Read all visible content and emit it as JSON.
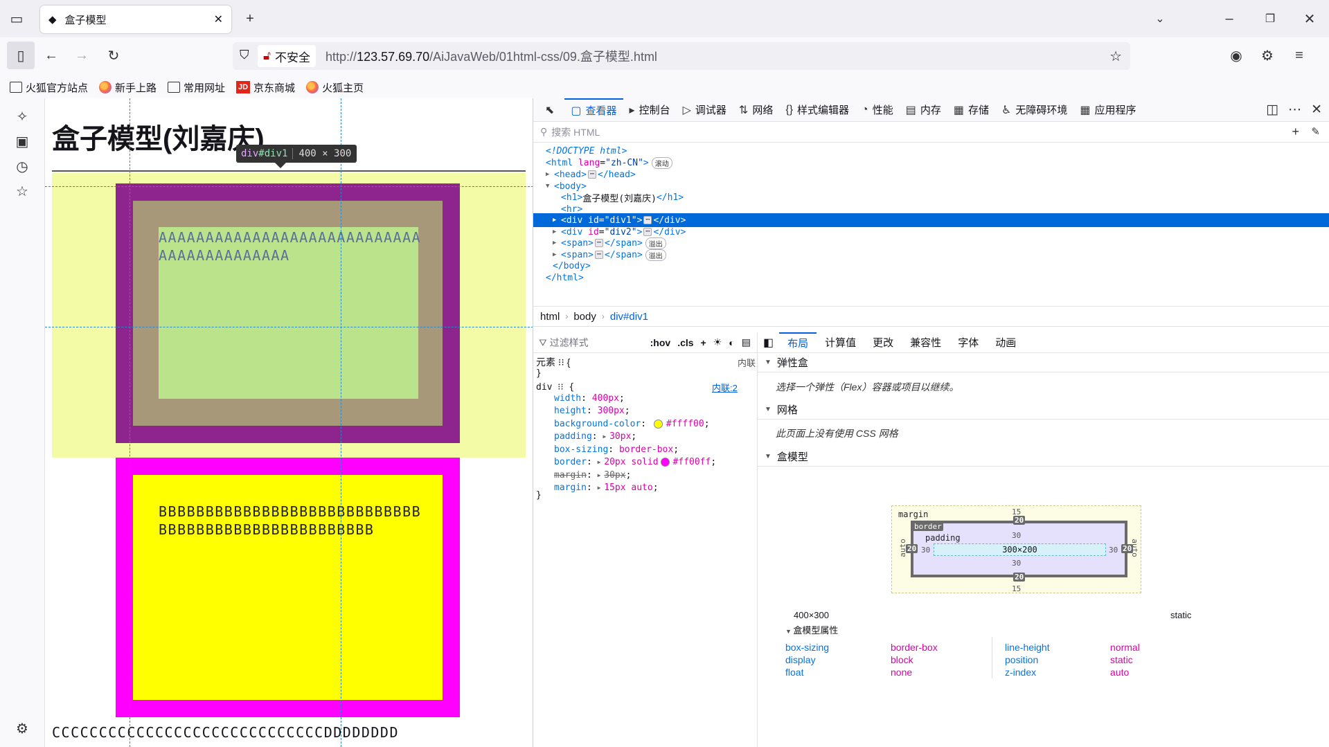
{
  "browser": {
    "tab_title": "盒子模型",
    "url_prefix": "http://",
    "url_host": "123.57.69.70",
    "url_path": "/AiJavaWeb/01html-css/09.盒子模型.html",
    "security_label": "不安全",
    "bookmarks": [
      "火狐官方站点",
      "新手上路",
      "常用网址",
      "京东商城",
      "火狐主页"
    ],
    "jd_logo": "JD"
  },
  "page": {
    "heading": "盒子模型(刘嘉庆)",
    "div1_text": "AAAAAAAAAAAAAAAAAAAAAAAAAAAAAAAAAAAAAAAAAA",
    "div2_text": "BBBBBBBBBBBBBBBBBBBBBBBBBBBBBBBBBBBBBBBBBBBBBBBBBBB",
    "span_text": "CCCCCCCCCCCCCCCCCCCCCCCCCCCCCDDDDDDDD",
    "tooltip_tag": "div",
    "tooltip_id": "#div1",
    "tooltip_dims": "400 × 300"
  },
  "devtools": {
    "tabs": [
      {
        "label": "查看器",
        "icon": "inspector-icon"
      },
      {
        "label": "控制台",
        "icon": "console-icon"
      },
      {
        "label": "调试器",
        "icon": "debugger-icon"
      },
      {
        "label": "网络",
        "icon": "network-icon"
      },
      {
        "label": "样式编辑器",
        "icon": "style-editor-icon"
      },
      {
        "label": "性能",
        "icon": "performance-icon"
      },
      {
        "label": "内存",
        "icon": "memory-icon"
      },
      {
        "label": "存储",
        "icon": "storage-icon"
      },
      {
        "label": "无障碍环境",
        "icon": "accessibility-icon"
      },
      {
        "label": "应用程序",
        "icon": "application-icon"
      }
    ],
    "search_placeholder": "搜索 HTML",
    "tree": {
      "doctype": "<!DOCTYPE html>",
      "html_open": "<html lang=\"zh-CN\">",
      "html_lang": "zh-CN",
      "scroll_badge": "滚动",
      "overflow_badge": "溢出",
      "h1_text": "盒子模型(刘嘉庆)",
      "div1_id": "div1",
      "div2_id": "div2"
    },
    "breadcrumbs": [
      "html",
      "body",
      "div#div1"
    ],
    "rules_filter": "过滤样式",
    "rules_hov": ":hov",
    "rules_cls": ".cls",
    "element_rule": "元素",
    "inline_label": "内联",
    "rule_selector": "div",
    "rule_source": "内联:2",
    "declarations": [
      {
        "name": "width",
        "value": "400px"
      },
      {
        "name": "height",
        "value": "300px"
      },
      {
        "name": "background-color",
        "value": "#ffff00",
        "swatch": "#ffff00"
      },
      {
        "name": "padding",
        "value": "30px"
      },
      {
        "name": "box-sizing",
        "value": "border-box"
      },
      {
        "name": "border",
        "value": "20px solid",
        "value2": "#ff00ff",
        "swatch": "#ff00ff"
      },
      {
        "name": "margin",
        "value": "30px",
        "strike": true
      },
      {
        "name": "margin",
        "value": "15px auto"
      }
    ],
    "layout_tabs": [
      "布局",
      "计算值",
      "更改",
      "兼容性",
      "字体",
      "动画"
    ],
    "flex_head": "弹性盒",
    "flex_note": "选择一个弹性（Flex）容器或项目以继续。",
    "grid_head": "网格",
    "grid_note": "此页面上没有使用 CSS 网格",
    "box_head": "盒模型",
    "box_model": {
      "margin_label": "margin",
      "border_label": "border",
      "padding_label": "padding",
      "margin_top": "15",
      "margin_bottom": "15",
      "margin_lr": "auto",
      "border_w": "20",
      "padding_w": "30",
      "content": "300×200"
    },
    "size_summary": "400×300",
    "position_summary": "static",
    "props_head": "盒模型属性",
    "props": [
      {
        "name": "box-sizing",
        "value": "border-box"
      },
      {
        "name": "display",
        "value": "block"
      },
      {
        "name": "float",
        "value": "none"
      },
      {
        "name": "line-height",
        "value": "normal"
      },
      {
        "name": "position",
        "value": "static"
      },
      {
        "name": "z-index",
        "value": "auto"
      }
    ]
  }
}
